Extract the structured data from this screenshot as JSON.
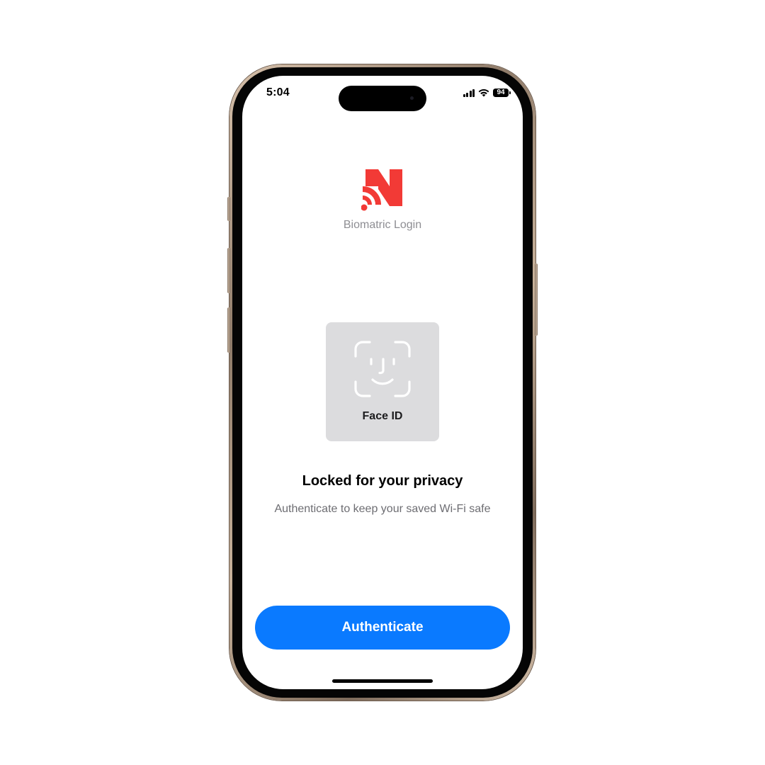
{
  "status_bar": {
    "time": "5:04",
    "battery_level": "94"
  },
  "app": {
    "title": "Biomatric Login",
    "logo_color": "#f23a36"
  },
  "face_id": {
    "label": "Face ID",
    "icon": "face-id-icon"
  },
  "message": {
    "headline": "Locked for your privacy",
    "subtext": "Authenticate to keep your saved Wi-Fi safe"
  },
  "actions": {
    "authenticate_label": "Authenticate",
    "accent_color": "#0a7aff"
  }
}
